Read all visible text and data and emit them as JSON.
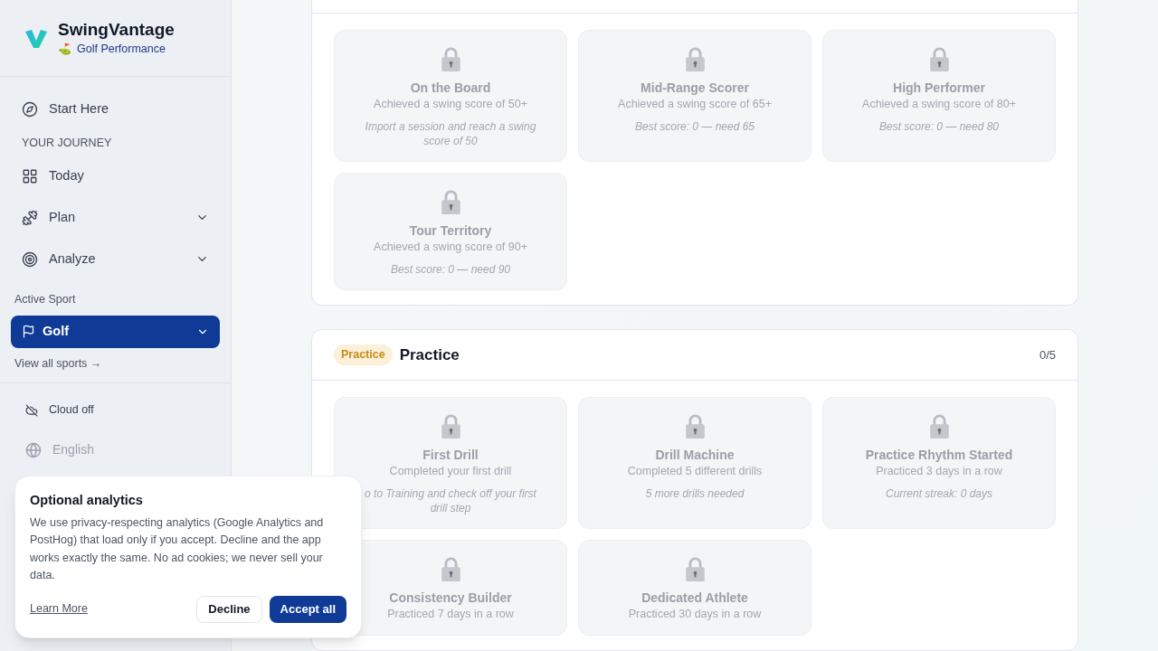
{
  "brand": {
    "name": "SwingVantage",
    "emoji": "⛳",
    "subtitle": "Golf Performance"
  },
  "sidebar": {
    "start": {
      "label": "Start Here"
    },
    "section_label": "YOUR JOURNEY",
    "items": [
      {
        "label": "Today",
        "expandable": false
      },
      {
        "label": "Plan",
        "expandable": true
      },
      {
        "label": "Analyze",
        "expandable": true
      }
    ],
    "active_sport_label": "Active Sport",
    "active_sport": "Golf",
    "view_all": "View all sports →",
    "cloud": "Cloud off",
    "language": "English"
  },
  "sections": [
    {
      "kind": "continued",
      "achievements": [
        {
          "title": "On the Board",
          "description": "Achieved a swing score of 50+",
          "hint": "Import a session and reach a swing score of 50"
        },
        {
          "title": "Mid-Range Scorer",
          "description": "Achieved a swing score of 65+",
          "hint": "Best score: 0 — need 65"
        },
        {
          "title": "High Performer",
          "description": "Achieved a swing score of 80+",
          "hint": "Best score: 0 — need 80"
        },
        {
          "title": "Tour Territory",
          "description": "Achieved a swing score of 90+",
          "hint": "Best score: 0 — need 90"
        }
      ]
    },
    {
      "kind": "full",
      "tag": "Practice",
      "title": "Practice",
      "count": "0/5",
      "achievements": [
        {
          "title": "First Drill",
          "description": "Completed your first drill",
          "hint": "o to Training and check off your first drill step"
        },
        {
          "title": "Drill Machine",
          "description": "Completed 5 different drills",
          "hint": "5 more drills needed"
        },
        {
          "title": "Practice Rhythm Started",
          "description": "Practiced 3 days in a row",
          "hint": "Current streak: 0 days"
        },
        {
          "title": "Consistency Builder",
          "description": "Practiced 7 days in a row"
        },
        {
          "title": "Dedicated Athlete",
          "description": "Practiced 30 days in a row"
        }
      ]
    }
  ],
  "consent": {
    "title": "Optional analytics",
    "body": "We use privacy-respecting analytics (Google Analytics and PostHog) that load only if you accept. Decline and the app works exactly the same. No ad cookies; we never sell your data.",
    "link": "Learn More",
    "buttons": [
      "Decline",
      "Accept all"
    ]
  }
}
